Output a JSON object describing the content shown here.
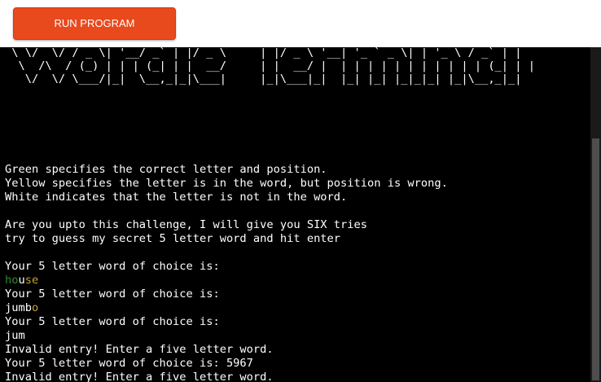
{
  "toolbar": {
    "run_label": "RUN PROGRAM"
  },
  "terminal": {
    "banner_art": " \\ \\/  \\/ / _ \\| '__/ _` | |/ _ \\     | |/ _ \\ '__| '_ ` _ \\| | '_ \\ / _` | |\n  \\  /\\  / (_) | | | (_| | |  __/     | |  __/ |  | | | | | | | | | | | (_| | |\n   \\/  \\/ \\___/|_|  \\__,_|_|\\___|     |_|\\___|_|  |_| |_| |_|_|_| |_|\\__,_|_|",
    "instructions": [
      "Green specifies the correct letter and position.",
      "Yellow specifies the letter is in the word, but position is wrong.",
      "White indicates that the letter is not in the word."
    ],
    "challenge": [
      "Are you upto this challenge, I will give you SIX tries",
      "try to guess my secret 5 letter word and hit enter"
    ],
    "prompt": "Your 5 letter word of choice is:",
    "prompt_with_input": "Your 5 letter word of choice is: 5967",
    "invalid_message": "Invalid entry! Enter a five letter word.",
    "raw_entry": "jum",
    "guesses": [
      {
        "letters": [
          {
            "char": "h",
            "state": "correct"
          },
          {
            "char": "o",
            "state": "correct"
          },
          {
            "char": "u",
            "state": "absent"
          },
          {
            "char": "s",
            "state": "present"
          },
          {
            "char": "e",
            "state": "present"
          }
        ]
      },
      {
        "letters": [
          {
            "char": "j",
            "state": "absent"
          },
          {
            "char": "u",
            "state": "absent"
          },
          {
            "char": "m",
            "state": "absent"
          },
          {
            "char": "b",
            "state": "absent"
          },
          {
            "char": "o",
            "state": "present"
          }
        ]
      }
    ],
    "colors": {
      "correct": "#2e8b2e",
      "present": "#c9a227",
      "absent": "#ffffff",
      "background": "#000000",
      "button": "#e8491d"
    }
  }
}
